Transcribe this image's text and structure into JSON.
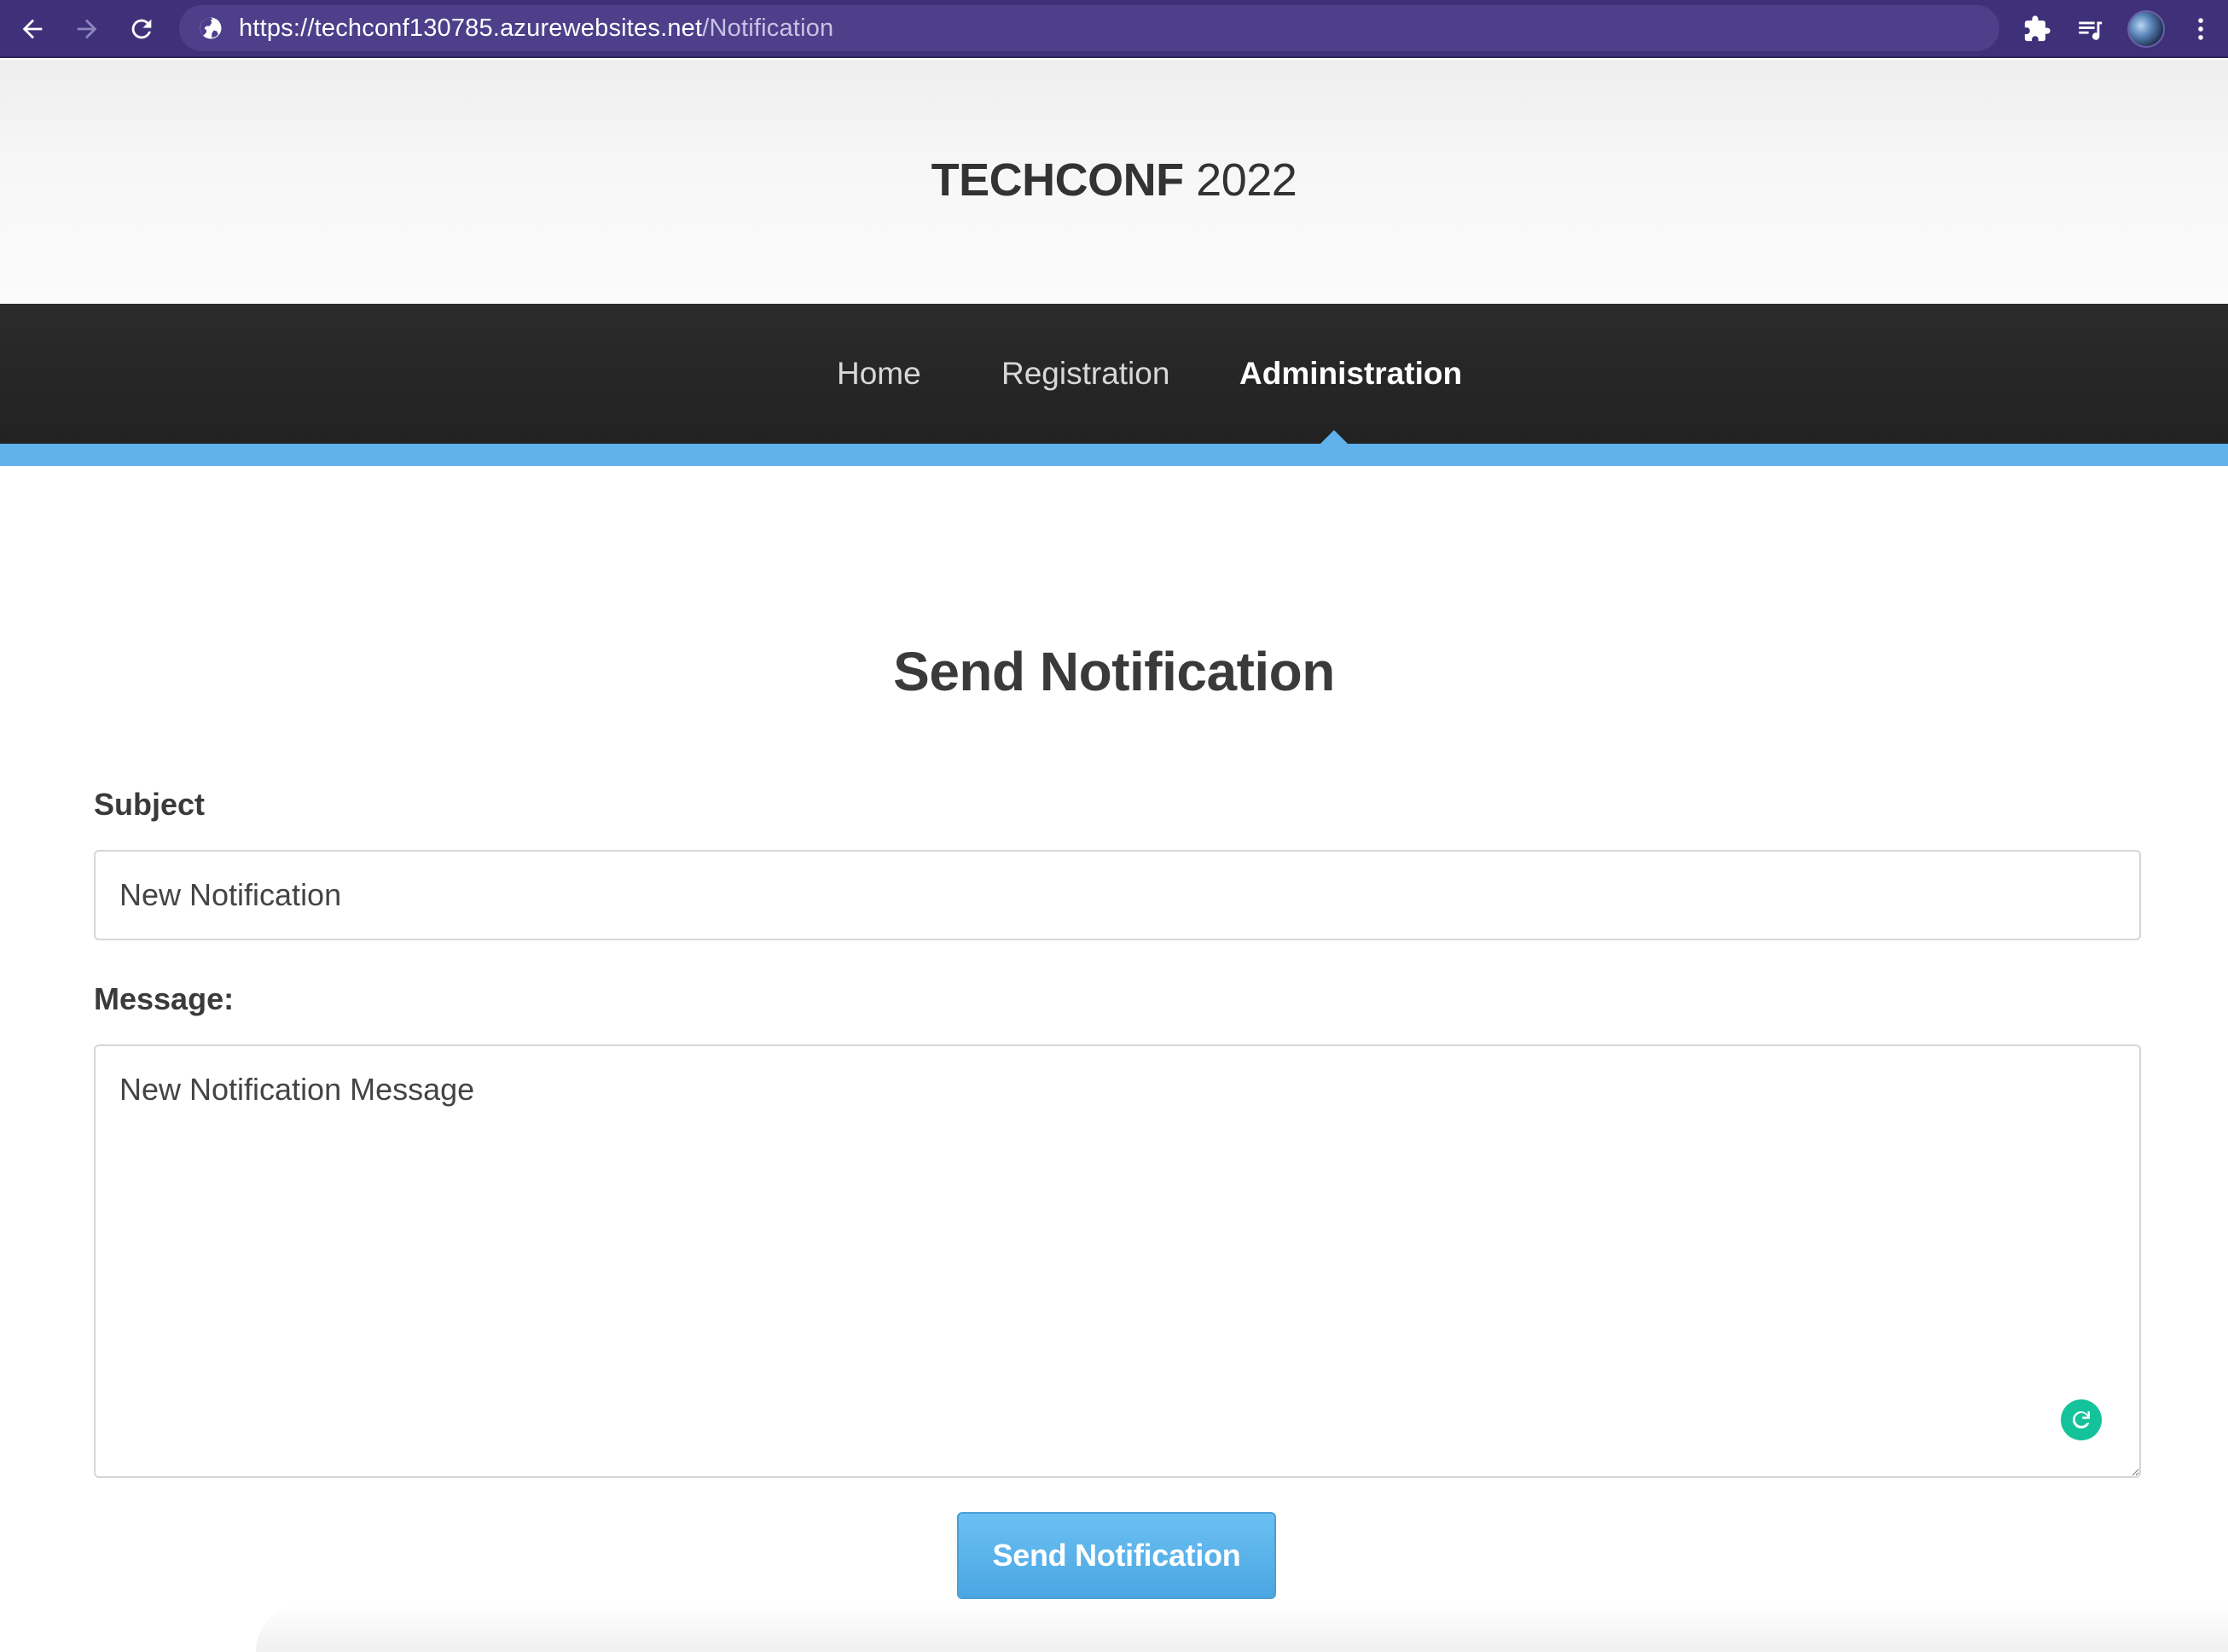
{
  "browser": {
    "url_host": "https://techconf130785.azurewebsites.net",
    "url_path": "/Notification",
    "icons": [
      "back-icon",
      "forward-icon",
      "reload-icon",
      "site-info-icon",
      "extensions-icon",
      "reading-list-icon",
      "profile-avatar",
      "more-menu-icon"
    ]
  },
  "header": {
    "logo_bold": "TECHCONF",
    "logo_year": "2022"
  },
  "nav": {
    "items": [
      {
        "label": "Home"
      },
      {
        "label": "Registration"
      },
      {
        "label": "Administration",
        "active": true
      }
    ],
    "accent_color": "#5fb2ec"
  },
  "page": {
    "title": "Send Notification"
  },
  "form": {
    "subject_label": "Subject",
    "subject_value": "New Notification",
    "message_label": "Message:",
    "message_value": "New Notification Message",
    "submit_label": "Send Notification"
  },
  "colors": {
    "browser_bar": "#3f3179",
    "nav_background": "#262626",
    "button": "#5ab4ea",
    "grammarly": "#15c39a"
  }
}
